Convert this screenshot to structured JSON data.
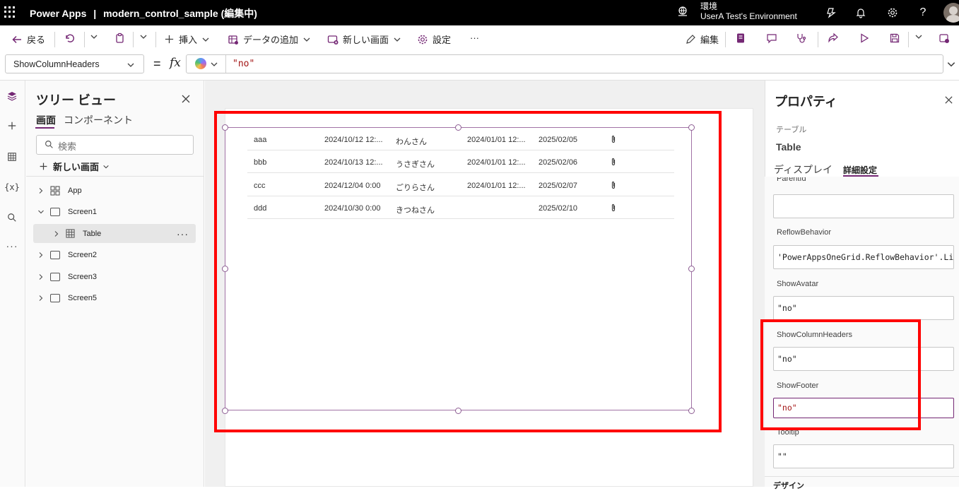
{
  "app": {
    "brand": "Power Apps",
    "separator": "|",
    "doc_title": "modern_control_sample (編集中)",
    "environment_label": "環境",
    "environment_name": "UserA Test's Environment"
  },
  "toolbar": {
    "back": "戻る",
    "insert": "挿入",
    "add_data": "データの追加",
    "new_screen": "新しい画面",
    "settings": "設定",
    "more": "···",
    "edit": "編集"
  },
  "formula_bar": {
    "property": "ShowColumnHeaders",
    "equals": "=",
    "fx": "fx",
    "value": "\"no\""
  },
  "tree": {
    "title": "ツリー ビュー",
    "tab_screens": "画面",
    "tab_components": "コンポーネント",
    "search_placeholder": "検索",
    "new_screen": "新しい画面",
    "items": [
      {
        "label": "App"
      },
      {
        "label": "Screen1"
      },
      {
        "label": "Table"
      },
      {
        "label": "Screen2"
      },
      {
        "label": "Screen3"
      },
      {
        "label": "Screen5"
      }
    ],
    "more": "···"
  },
  "table": {
    "rows": [
      [
        "aaa",
        "2024/10/12 12:...",
        "わんさん",
        "2024/01/01 12:...",
        "2025/02/05"
      ],
      [
        "bbb",
        "2024/10/13 12:...",
        "うさぎさん",
        "2024/01/01 12:...",
        "2025/02/06"
      ],
      [
        "ccc",
        "2024/12/04 0:00",
        "ごりらさん",
        "2024/01/01 12:...",
        "2025/02/07"
      ],
      [
        "ddd",
        "2024/10/30 0:00",
        "きつねさん",
        "",
        "2025/02/10"
      ]
    ]
  },
  "properties": {
    "title": "プロパティ",
    "control_type": "テーブル",
    "control_name": "Table",
    "tab_display": "ディスプレイ",
    "tab_advanced": "詳細設定",
    "cut_label": "ParentId",
    "fields": [
      {
        "label": "",
        "value": ""
      },
      {
        "label": "ReflowBehavior",
        "value": "'PowerAppsOneGrid.ReflowBehavior'.Lis..."
      },
      {
        "label": "ShowAvatar",
        "value": "\"no\""
      },
      {
        "label": "ShowColumnHeaders",
        "value": "\"no\""
      },
      {
        "label": "ShowFooter",
        "value": "\"no\""
      },
      {
        "label": "Tooltip",
        "value": "\"\""
      }
    ],
    "design_section": "デザイン"
  },
  "colors": {
    "accent": "#742774",
    "highlight": "#ff0000",
    "string_literal": "#a31515"
  }
}
